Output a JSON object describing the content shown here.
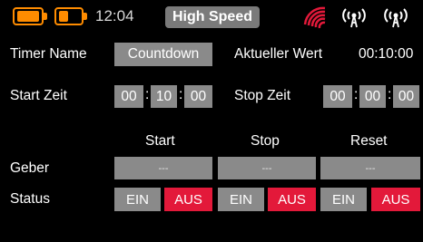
{
  "status_bar": {
    "time": "12:04",
    "mode": "High Speed"
  },
  "timer_name": {
    "label": "Timer Name",
    "value": "Countdown"
  },
  "current_value": {
    "label": "Aktueller Wert",
    "value": "00:10:00"
  },
  "start_time": {
    "label": "Start Zeit",
    "hours": "00",
    "minutes": "10",
    "seconds": "00"
  },
  "stop_time": {
    "label": "Stop Zeit",
    "hours": "00",
    "minutes": "00",
    "seconds": "00"
  },
  "separator": ":",
  "columns": {
    "start": "Start",
    "stop": "Stop",
    "reset": "Reset"
  },
  "geber": {
    "label": "Geber",
    "start": "---",
    "stop": "---",
    "reset": "---"
  },
  "status": {
    "label": "Status",
    "on": "EIN",
    "off": "AUS"
  },
  "colors": {
    "accent_orange": "#ff8c00",
    "active_red": "#e3193a",
    "field_gray": "#8a8a8a"
  },
  "icons": [
    "battery-icon",
    "battery-icon",
    "signal-strength-icon",
    "transmitter-antenna-icon",
    "receiver-antenna-icon"
  ]
}
